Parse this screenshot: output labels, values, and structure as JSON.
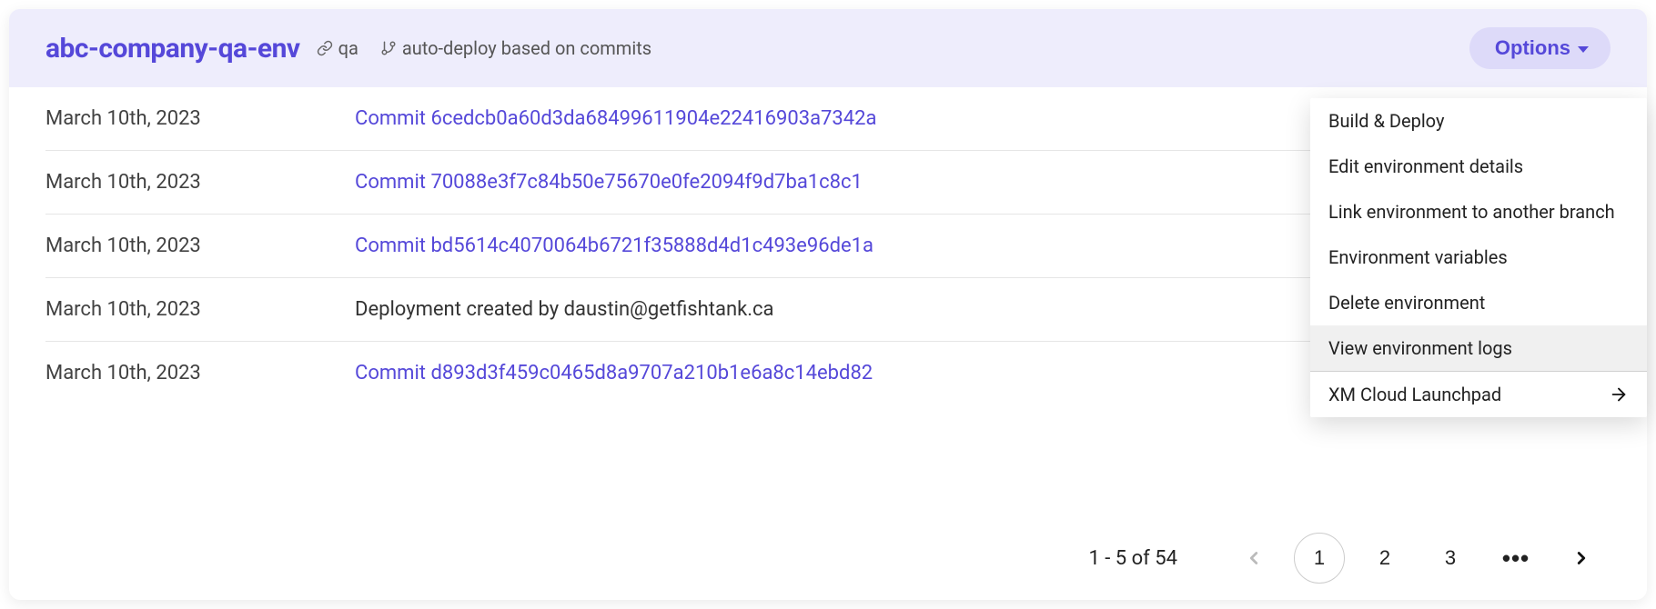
{
  "header": {
    "title": "abc-company-qa-env",
    "tag_link": "qa",
    "tag_branch": "auto-deploy based on commits",
    "options_label": "Options"
  },
  "rows": [
    {
      "date": "March 10th, 2023",
      "text": "Commit 6cedcb0a60d3da68499611904e22416903a7342a",
      "is_commit": true
    },
    {
      "date": "March 10th, 2023",
      "text": "Commit 70088e3f7c84b50e75670e0fe2094f9d7ba1c8c1",
      "is_commit": true
    },
    {
      "date": "March 10th, 2023",
      "text": "Commit bd5614c4070064b6721f35888d4d1c493e96de1a",
      "is_commit": true
    },
    {
      "date": "March 10th, 2023",
      "text": "Deployment created by daustin@getfishtank.ca",
      "is_commit": false
    },
    {
      "date": "March 10th, 2023",
      "text": "Commit d893d3f459c0465d8a9707a210b1e6a8c14ebd82",
      "is_commit": true
    }
  ],
  "dropdown": {
    "items": [
      {
        "label": "Build & Deploy",
        "active": false
      },
      {
        "label": "Edit environment details",
        "active": false
      },
      {
        "label": "Link environment to another branch",
        "active": false
      },
      {
        "label": "Environment variables",
        "active": false
      },
      {
        "label": "Delete environment",
        "active": false
      },
      {
        "label": "View environment logs",
        "active": true
      }
    ],
    "external": {
      "label": "XM Cloud Launchpad"
    }
  },
  "pagination": {
    "info": "1 - 5 of 54",
    "pages": [
      "1",
      "2",
      "3"
    ],
    "current_index": 0,
    "ellipsis": "•••"
  }
}
